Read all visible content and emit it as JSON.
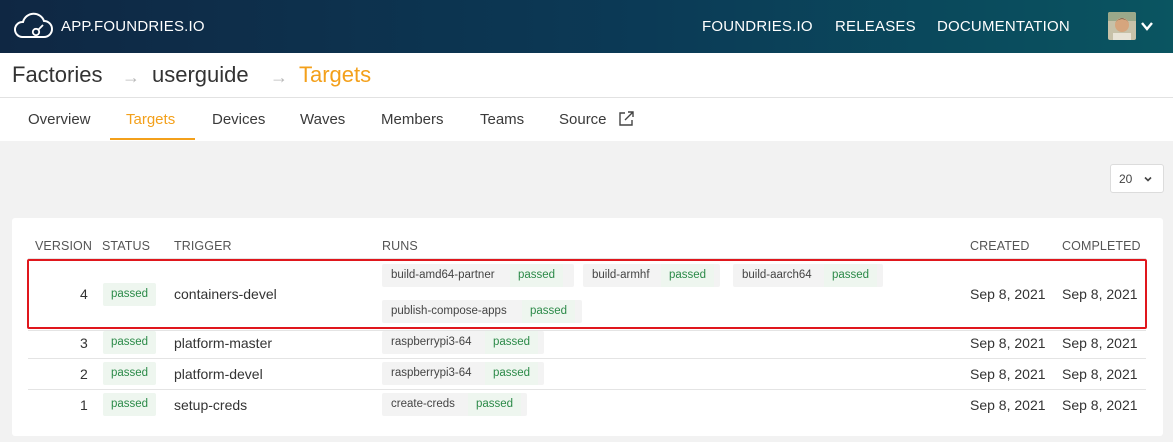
{
  "header": {
    "app_name": "APP.FOUNDRIES.IO",
    "nav": [
      "FOUNDRIES.IO",
      "RELEASES",
      "DOCUMENTATION"
    ]
  },
  "breadcrumb": [
    "Factories",
    "userguide",
    "Targets"
  ],
  "breadcrumb_separator": "→",
  "tabs": [
    "Overview",
    "Targets",
    "Devices",
    "Waves",
    "Members",
    "Teams",
    "Source"
  ],
  "active_tab": "Targets",
  "page_size": "20",
  "table": {
    "columns": [
      "VERSION",
      "STATUS",
      "TRIGGER",
      "RUNS",
      "CREATED",
      "COMPLETED"
    ],
    "rows": [
      {
        "version": "4",
        "status": "passed",
        "trigger": "containers-devel",
        "runs": [
          {
            "name": "build-amd64-partner",
            "status": "passed"
          },
          {
            "name": "build-armhf",
            "status": "passed"
          },
          {
            "name": "build-aarch64",
            "status": "passed"
          },
          {
            "name": "publish-compose-apps",
            "status": "passed"
          }
        ],
        "created": "Sep 8, 2021",
        "completed": "Sep 8, 2021"
      },
      {
        "version": "3",
        "status": "passed",
        "trigger": "platform-master",
        "runs": [
          {
            "name": "raspberrypi3-64",
            "status": "passed"
          }
        ],
        "created": "Sep 8, 2021",
        "completed": "Sep 8, 2021"
      },
      {
        "version": "2",
        "status": "passed",
        "trigger": "platform-devel",
        "runs": [
          {
            "name": "raspberrypi3-64",
            "status": "passed"
          }
        ],
        "created": "Sep 8, 2021",
        "completed": "Sep 8, 2021"
      },
      {
        "version": "1",
        "status": "passed",
        "trigger": "setup-creds",
        "runs": [
          {
            "name": "create-creds",
            "status": "passed"
          }
        ],
        "created": "Sep 8, 2021",
        "completed": "Sep 8, 2021"
      }
    ]
  },
  "colors": {
    "accent": "#f3a01b",
    "passed_text": "#2b8a48",
    "passed_bg": "#eef6ef",
    "highlight": "#e0171d"
  },
  "icons": [
    "cloud-logo-icon",
    "chevron-down-icon",
    "external-link-icon"
  ]
}
